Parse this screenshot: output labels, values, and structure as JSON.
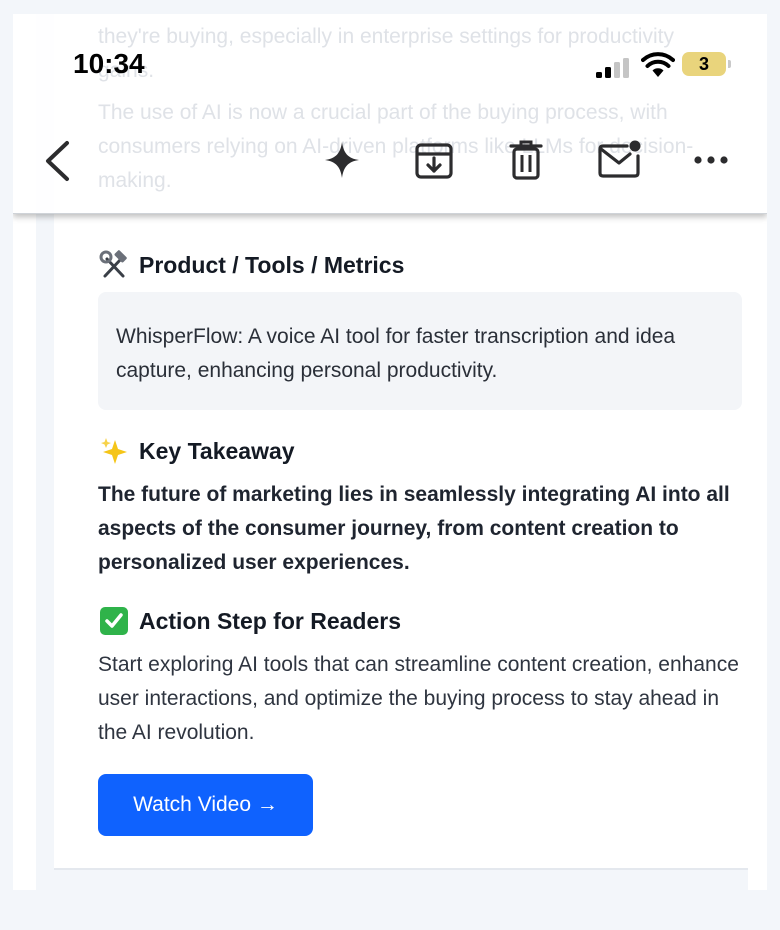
{
  "status_bar": {
    "time": "10:34",
    "battery_level": "3",
    "signal_icon": "cellular-signal-icon",
    "wifi_icon": "wifi-icon"
  },
  "background_text": {
    "lines": [
      "they're buying, especially in enterprise settings for productivity gains.",
      "The use of AI is now a crucial part of the buying process, with consumers relying on AI-driven platforms like LLMs for decision-making."
    ]
  },
  "toolbar": {
    "icons": [
      "back-chevron-icon",
      "sparkle-icon",
      "archive-icon",
      "trash-icon",
      "mark-unread-icon",
      "more-icon"
    ]
  },
  "email": {
    "tools_heading": "Product / Tools / Metrics",
    "tools_text": "WhisperFlow: A voice AI tool for faster transcription and idea capture, enhancing personal productivity.",
    "takeaway_heading": "Key Takeaway",
    "takeaway_text": "The future of marketing lies in seamlessly integrating AI into all aspects of the consumer journey, from content creation to personalized user experiences.",
    "action_heading": "Action Step for Readers",
    "action_text": "Start exploring AI tools that can streamline content creation, enhance user interactions, and optimize the buying process to stay ahead in the AI revolution.",
    "watch_button_label": "Watch Video →"
  },
  "colors": {
    "accent": "#0f62fe",
    "checkmark_green": "#2fb34a",
    "battery_yellow": "#e9d47c"
  }
}
